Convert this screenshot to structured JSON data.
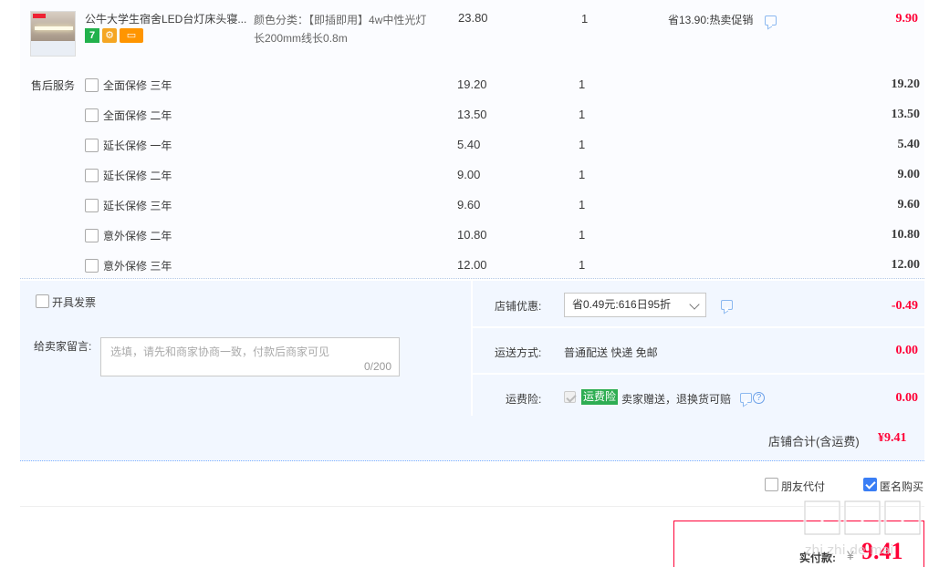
{
  "product": {
    "title": "公牛大学生宿舍LED台灯床头寝...",
    "sku_label": "颜色分类：",
    "sku_value": "【即插即用】4w中性光灯长200mm线长0.8m",
    "price": "23.80",
    "quantity": "1",
    "promo": "省13.90:热卖促销",
    "subtotal": "9.90",
    "tags": [
      "7",
      "",
      ""
    ]
  },
  "services": {
    "label": "售后服务",
    "items": [
      {
        "name": "全面保修 三年",
        "price": "19.20",
        "qty": "1",
        "total": "19.20"
      },
      {
        "name": "全面保修 二年",
        "price": "13.50",
        "qty": "1",
        "total": "13.50"
      },
      {
        "name": "延长保修 一年",
        "price": "5.40",
        "qty": "1",
        "total": "5.40"
      },
      {
        "name": "延长保修 二年",
        "price": "9.00",
        "qty": "1",
        "total": "9.00"
      },
      {
        "name": "延长保修 三年",
        "price": "9.60",
        "qty": "1",
        "total": "9.60"
      },
      {
        "name": "意外保修 二年",
        "price": "10.80",
        "qty": "1",
        "total": "10.80"
      },
      {
        "name": "意外保修 三年",
        "price": "12.00",
        "qty": "1",
        "total": "12.00"
      }
    ]
  },
  "invoice": {
    "label": "开具发票"
  },
  "message": {
    "label": "给卖家留言:",
    "placeholder": "选填，请先和商家协商一致，付款后商家可见",
    "counter": "0/200"
  },
  "shop_discount": {
    "label": "店铺优惠:",
    "selected": "省0.49元:616日95折",
    "amount": "-0.49"
  },
  "shipping": {
    "label": "运送方式:",
    "value": "普通配送 快递 免邮",
    "amount": "0.00"
  },
  "insurance": {
    "label": "运费险:",
    "tag": "运费险",
    "text": "卖家赠送，退换货可赔",
    "amount": "0.00"
  },
  "shop_total": {
    "label": "店铺合计(含运费)",
    "amount": "¥9.41"
  },
  "options": {
    "friend_pay": "朋友代付",
    "anonymous": "匿名购买"
  },
  "payment": {
    "label": "实付款:",
    "currency": "¥",
    "amount": "9.41"
  },
  "watermark": "值 什么值得买 zhi zhi de mai"
}
